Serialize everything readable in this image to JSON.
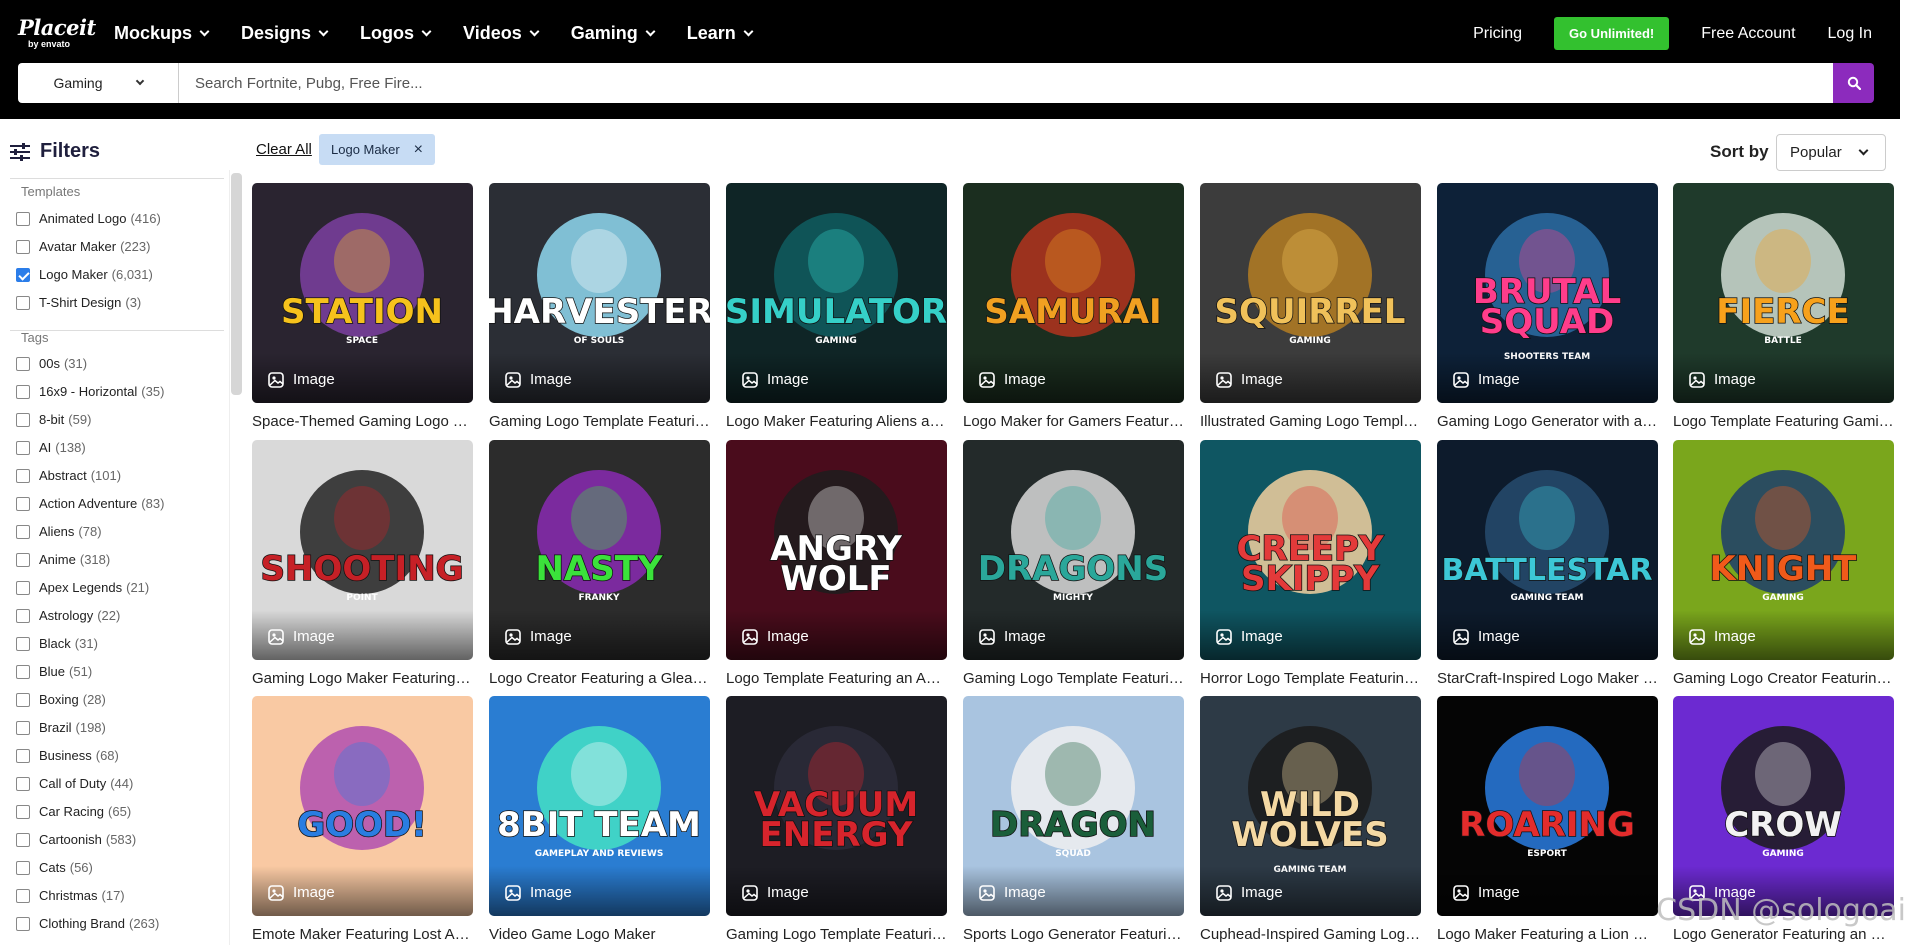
{
  "header": {
    "logo_line1": "Placeit",
    "logo_line2": "by envato",
    "nav": [
      "Mockups",
      "Designs",
      "Logos",
      "Videos",
      "Gaming",
      "Learn"
    ],
    "pricing": "Pricing",
    "cta": "Go Unlimited!",
    "free_account": "Free Account",
    "login": "Log In"
  },
  "search": {
    "category": "Gaming",
    "placeholder": "Search Fortnite, Pubg, Free Fire...",
    "value": ""
  },
  "sidebar": {
    "title": "Filters",
    "templates_label": "Templates",
    "templates": [
      {
        "label": "Animated Logo",
        "count": "(416)",
        "checked": false
      },
      {
        "label": "Avatar Maker",
        "count": "(223)",
        "checked": false
      },
      {
        "label": "Logo Maker",
        "count": "(6,031)",
        "checked": true
      },
      {
        "label": "T-Shirt Design",
        "count": "(3)",
        "checked": false
      }
    ],
    "tags_label": "Tags",
    "tags": [
      {
        "label": "00s",
        "count": "(31)"
      },
      {
        "label": "16x9 - Horizontal",
        "count": "(35)"
      },
      {
        "label": "8-bit",
        "count": "(59)"
      },
      {
        "label": "AI",
        "count": "(138)"
      },
      {
        "label": "Abstract",
        "count": "(101)"
      },
      {
        "label": "Action Adventure",
        "count": "(83)"
      },
      {
        "label": "Aliens",
        "count": "(78)"
      },
      {
        "label": "Anime",
        "count": "(318)"
      },
      {
        "label": "Apex Legends",
        "count": "(21)"
      },
      {
        "label": "Astrology",
        "count": "(22)"
      },
      {
        "label": "Black",
        "count": "(31)"
      },
      {
        "label": "Blue",
        "count": "(51)"
      },
      {
        "label": "Boxing",
        "count": "(28)"
      },
      {
        "label": "Brazil",
        "count": "(198)"
      },
      {
        "label": "Business",
        "count": "(68)"
      },
      {
        "label": "Call of Duty",
        "count": "(44)"
      },
      {
        "label": "Car Racing",
        "count": "(65)"
      },
      {
        "label": "Cartoonish",
        "count": "(583)"
      },
      {
        "label": "Cats",
        "count": "(56)"
      },
      {
        "label": "Christmas",
        "count": "(17)"
      },
      {
        "label": "Clothing Brand",
        "count": "(263)"
      }
    ]
  },
  "toolbar": {
    "clear_all": "Clear All",
    "chip": "Logo Maker",
    "chip_x": "×",
    "sort_label": "Sort by",
    "sort_value": "Popular"
  },
  "badge_label": "Image",
  "cards": [
    {
      "title": "Space-Themed Gaming Logo Template",
      "art": "STATION",
      "sub": "SPACE",
      "bg": "#2a2430",
      "c1": "#f6c21c",
      "c2": "#7b3fa0"
    },
    {
      "title": "Gaming Logo Template Featuring a Harvester",
      "art": "HARVESTER",
      "sub": "OF SOULS",
      "bg": "#2b2e35",
      "c1": "#ffffff",
      "c2": "#8fd8f0"
    },
    {
      "title": "Logo Maker Featuring Aliens and a Simulator",
      "art": "SIMULATOR",
      "sub": "GAMING",
      "bg": "#0f2526",
      "c1": "#35d0c8",
      "c2": "#0f5d60"
    },
    {
      "title": "Logo Maker for Gamers Featuring a Samurai",
      "art": "SAMURAI",
      "sub": "",
      "bg": "#1b2e1f",
      "c1": "#f0a021",
      "c2": "#b3321f"
    },
    {
      "title": "Illustrated Gaming Logo Template Squirrel",
      "art": "SQUIRREL",
      "sub": "GAMING",
      "bg": "#3c3c3c",
      "c1": "#f0c15a",
      "c2": "#b47c22"
    },
    {
      "title": "Gaming Logo Generator with a Brutal Squad",
      "art": "BRUTAL SQUAD",
      "sub": "SHOOTERS TEAM",
      "bg": "#0d2138",
      "c1": "#ff3d8b",
      "c2": "#2d6ca3"
    },
    {
      "title": "Logo Template Featuring Gaming Fierce Battle",
      "art": "FIERCE",
      "sub": "BATTLE",
      "bg": "#1f3a2b",
      "c1": "#f7a11b",
      "c2": "#d0ddd4"
    },
    {
      "title": "Gaming Logo Maker Featuring Shooting Point",
      "art": "SHOOTING",
      "sub": "POINT",
      "bg": "#d9d9d9",
      "c1": "#c62026",
      "c2": "#222222"
    },
    {
      "title": "Logo Creator Featuring a Gleaming Nasty Franky",
      "art": "NASTY",
      "sub": "FRANKY",
      "bg": "#2c2c2c",
      "c1": "#3be23b",
      "c2": "#8a2ab3"
    },
    {
      "title": "Logo Template Featuring an Angry Wolf",
      "art": "ANGRY WOLF",
      "sub": "",
      "bg": "#4a0c1c",
      "c1": "#ffffff",
      "c2": "#1d1d1d"
    },
    {
      "title": "Gaming Logo Template Featuring Mighty Dragons",
      "art": "DRAGONS",
      "sub": "MIGHTY",
      "bg": "#232a2a",
      "c1": "#2aa79a",
      "c2": "#d9d9d9"
    },
    {
      "title": "Horror Logo Template Featuring Creepy Skippy",
      "art": "CREEPY SKIPPY",
      "sub": "",
      "bg": "#0f5662",
      "c1": "#e33a3a",
      "c2": "#f2d0a0"
    },
    {
      "title": "StarCraft-Inspired Logo Maker Battlestar",
      "art": "BATTLESTAR",
      "sub": "GAMING TEAM",
      "bg": "#0d1b2c",
      "c1": "#3cc7d6",
      "c2": "#274b6e"
    },
    {
      "title": "Gaming Logo Creator Featuring a Knight",
      "art": "KNIGHT",
      "sub": "GAMING",
      "bg": "#7aa61c",
      "c1": "#f05a1a",
      "c2": "#1d3d6b"
    },
    {
      "title": "Emote Maker Featuring Lost Ark Character",
      "art": "GOOD!",
      "sub": "",
      "bg": "#f9c9a3",
      "c1": "#2a7de1",
      "c2": "#b24fb0"
    },
    {
      "title": "Video Game Logo Maker",
      "art": "8BIT TEAM",
      "sub": "GAMEPLAY AND REVIEWS",
      "bg": "#2a7dd2",
      "c1": "#ffffff",
      "c2": "#44e0c5"
    },
    {
      "title": "Gaming Logo Template Featuring Vacuum Energy",
      "art": "VACUUM ENERGY",
      "sub": "",
      "bg": "#1d1d24",
      "c1": "#d7242c",
      "c2": "#2b2b3a"
    },
    {
      "title": "Sports Logo Generator Featuring a Dragon",
      "art": "DRAGON",
      "sub": "SQUAD",
      "bg": "#a9c4e0",
      "c1": "#1a5e3a",
      "c2": "#f0f0f0"
    },
    {
      "title": "Cuphead-Inspired Gaming Logo Template",
      "art": "WILD WOLVES",
      "sub": "GAMING TEAM",
      "bg": "#2d3a46",
      "c1": "#f4d9a4",
      "c2": "#1b1b1b"
    },
    {
      "title": "Logo Maker Featuring a Lion Roaring",
      "art": "ROARING",
      "sub": "ESPORT",
      "bg": "#050505",
      "c1": "#e32c2c",
      "c2": "#2a7de1"
    },
    {
      "title": "Logo Generator Featuring an Evil Crow",
      "art": "CROW",
      "sub": "GAMING",
      "bg": "#6c2ad1",
      "c1": "#f2f2f2",
      "c2": "#1b1b1b"
    }
  ],
  "watermark": "CSDN @sologoai"
}
